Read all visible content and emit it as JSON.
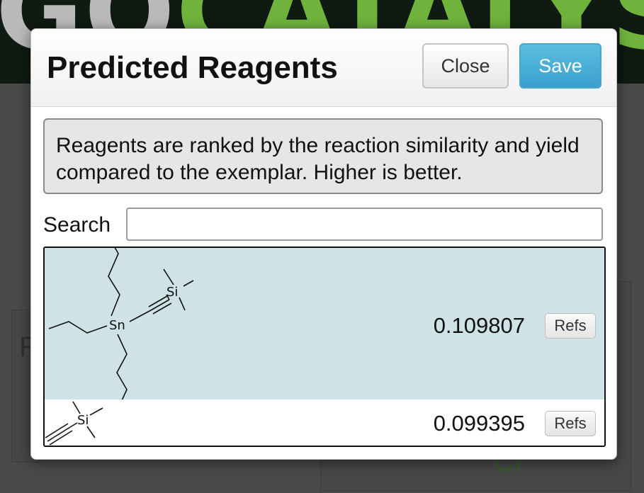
{
  "background": {
    "logo_part_a": "GO",
    "logo_part_b": "CATALYSIS",
    "left_card_letter": "R",
    "right_card_text": "Cl"
  },
  "modal": {
    "title": "Predicted Reagents",
    "close_label": "Close",
    "save_label": "Save",
    "info_text": "Reagents are ranked by the reaction similarity and yield compared to the exemplar. Higher is better.",
    "search_label": "Search",
    "search_value": "",
    "results": [
      {
        "molecule_labels": [
          "Sn",
          "Si"
        ],
        "score": "0.109807",
        "refs_label": "Refs",
        "highlighted": true
      },
      {
        "molecule_labels": [
          "Si"
        ],
        "score": "0.099395",
        "refs_label": "Refs",
        "highlighted": false
      }
    ]
  },
  "colors": {
    "save_button": "#5bc0de",
    "highlight_row": "#cfe3e7",
    "logo_green": "#6fb33d"
  }
}
